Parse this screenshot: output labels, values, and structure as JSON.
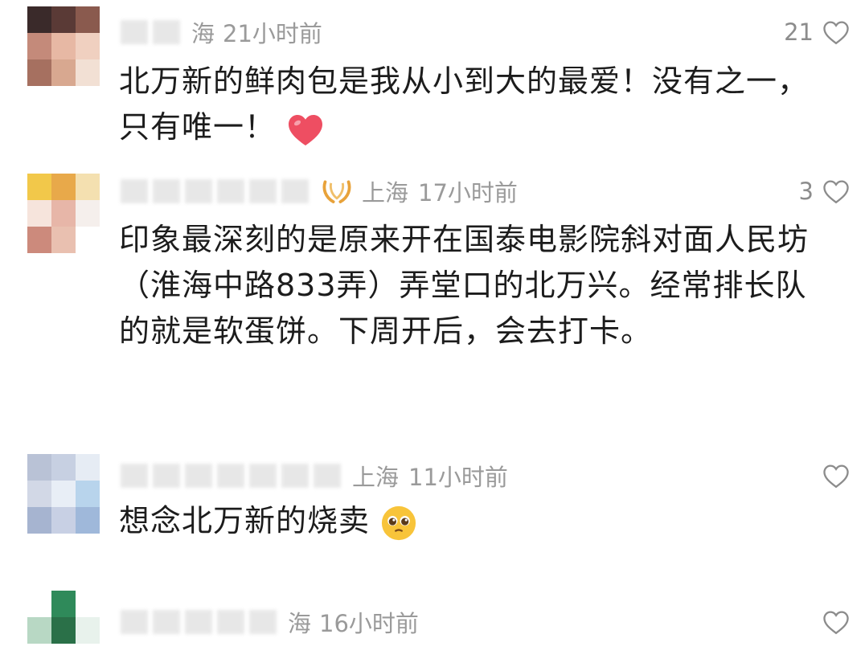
{
  "comments": [
    {
      "time_prefix": "海",
      "time": "21小时前",
      "likes": "21",
      "text": "北万新的鲜肉包是我从小到大的最爱！没有之一，只有唯一！",
      "emoji": "heart-emoji",
      "avatar_colors": [
        "#3a2a2a",
        "#5a3a36",
        "#8a5a4e",
        "#c48a7a",
        "#e7b8a4",
        "#f0d0c0",
        "#a67060",
        "#d8a890",
        "#f2e0d4"
      ]
    },
    {
      "location": "上海",
      "time": "17小时前",
      "likes": "3",
      "text": "印象最深刻的是原来开在国泰电影院斜对面人民坊（淮海中路833弄）弄堂口的北万兴。经常排长队的就是软蛋饼。下周开后，会去打卡。",
      "avatar_colors": [
        "#f2c84a",
        "#e8a94a",
        "#f4e0b0",
        "#f6e4dc",
        "#e7b6a8",
        "#f5efec",
        "#cc8a7c",
        "#e9c0b0",
        "#ffffff"
      ]
    },
    {
      "location": "上海",
      "time": "11小时前",
      "likes": "",
      "text": "想念北万新的烧卖",
      "emoji": "pleading-face-emoji",
      "avatar_colors": [
        "#b9c2d6",
        "#c7d0e2",
        "#e6ecf4",
        "#d2d8e6",
        "#e8eef6",
        "#b8d4ec",
        "#a6b4d0",
        "#c8d0e4",
        "#9fb8da"
      ]
    },
    {
      "time_prefix": "海",
      "time": "16小时前",
      "likes": "",
      "avatar_colors": [
        "#ffffff",
        "#2f8a5a",
        "#ffffff",
        "#b8d8c4",
        "#2a7048",
        "#e8f2ec",
        "#ffffff",
        "#ffffff",
        "#ffffff"
      ]
    }
  ],
  "colors": {
    "meta": "#9a9a9a",
    "text": "#1c1c1c",
    "heart": "#ee4e62",
    "badge": "#e8a23a"
  }
}
